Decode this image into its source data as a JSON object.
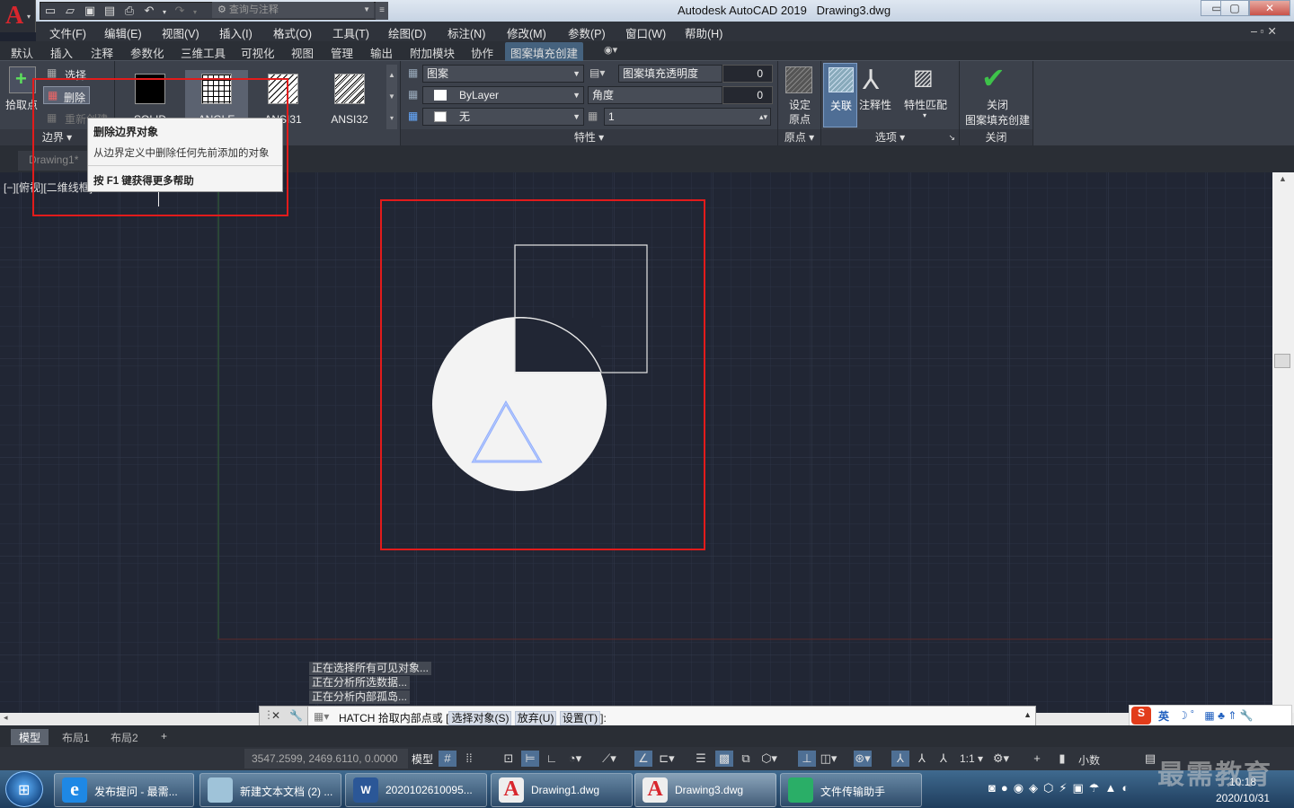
{
  "app": {
    "title": "Autodesk AutoCAD 2019",
    "document": "Drawing3.dwg",
    "workspace_search": "查询与注释",
    "window_buttons": [
      "▭",
      "▢",
      "✕"
    ]
  },
  "menu": [
    "文件(F)",
    "编辑(E)",
    "视图(V)",
    "插入(I)",
    "格式(O)",
    "工具(T)",
    "绘图(D)",
    "标注(N)",
    "修改(M)",
    "参数(P)",
    "窗口(W)",
    "帮助(H)"
  ],
  "ribbon_tabs": [
    "默认",
    "插入",
    "注释",
    "参数化",
    "三维工具",
    "可视化",
    "视图",
    "管理",
    "输出",
    "附加模块",
    "协作",
    "图案填充创建"
  ],
  "ribbon": {
    "boundary": {
      "pick_label": "拾取点",
      "select_label": "选择",
      "remove_label": "删除",
      "recreate_label": "重新创建",
      "panel_label": "边界"
    },
    "patterns": [
      "SOLID",
      "ANGLE",
      "ANSI31",
      "ANSI32"
    ],
    "properties": {
      "type": "图案",
      "color": "ByLayer",
      "bgcolor": "无",
      "transparency_label": "图案填充透明度",
      "transparency_value": "0",
      "angle_label": "角度",
      "angle_value": "0",
      "scale_value": "1",
      "panel_label": "特性"
    },
    "origin": {
      "set_label": "设定",
      "origin_label": "原点",
      "panel_label": "原点"
    },
    "options": {
      "associative": "关联",
      "annotative": "注释性",
      "match": "特性匹配",
      "panel_label": "选项"
    },
    "close": {
      "label1": "关闭",
      "label2": "图案填充创建",
      "panel_label": "关闭"
    }
  },
  "doc_tab": "Drawing1*",
  "view_label": "[−][俯视][二维线框]",
  "tooltip": {
    "title": "删除边界对象",
    "desc": "从边界定义中删除任何先前添加的对象",
    "help": "按 F1 键获得更多帮助"
  },
  "command_history": [
    "正在选择所有可见对象...",
    "正在分析所选数据...",
    "正在分析内部孤岛..."
  ],
  "command_line": {
    "prompt": "HATCH 拾取内部点或 [",
    "options": [
      "选择对象(S)",
      "放弃(U)",
      "设置(T)"
    ],
    "end": "]:"
  },
  "layout_tabs": [
    "模型",
    "布局1",
    "布局2"
  ],
  "status": {
    "coords": "3547.2599, 2469.6110, 0.0000",
    "model": "模型",
    "scale": "1:1",
    "units": "小数"
  },
  "ime": {
    "lang": "英"
  },
  "taskbar": {
    "items": [
      "发布提问 - 最需...",
      "新建文本文档 (2) ...",
      "2020102610095...",
      "Drawing1.dwg",
      "Drawing3.dwg",
      "文件传输助手"
    ],
    "time": "10:18",
    "date": "2020/10/31"
  },
  "watermark": "最需教育",
  "colors": {
    "accent_red": "#e21b1b",
    "canvas": "#212634",
    "hatch_blue": "#6f97ff"
  }
}
